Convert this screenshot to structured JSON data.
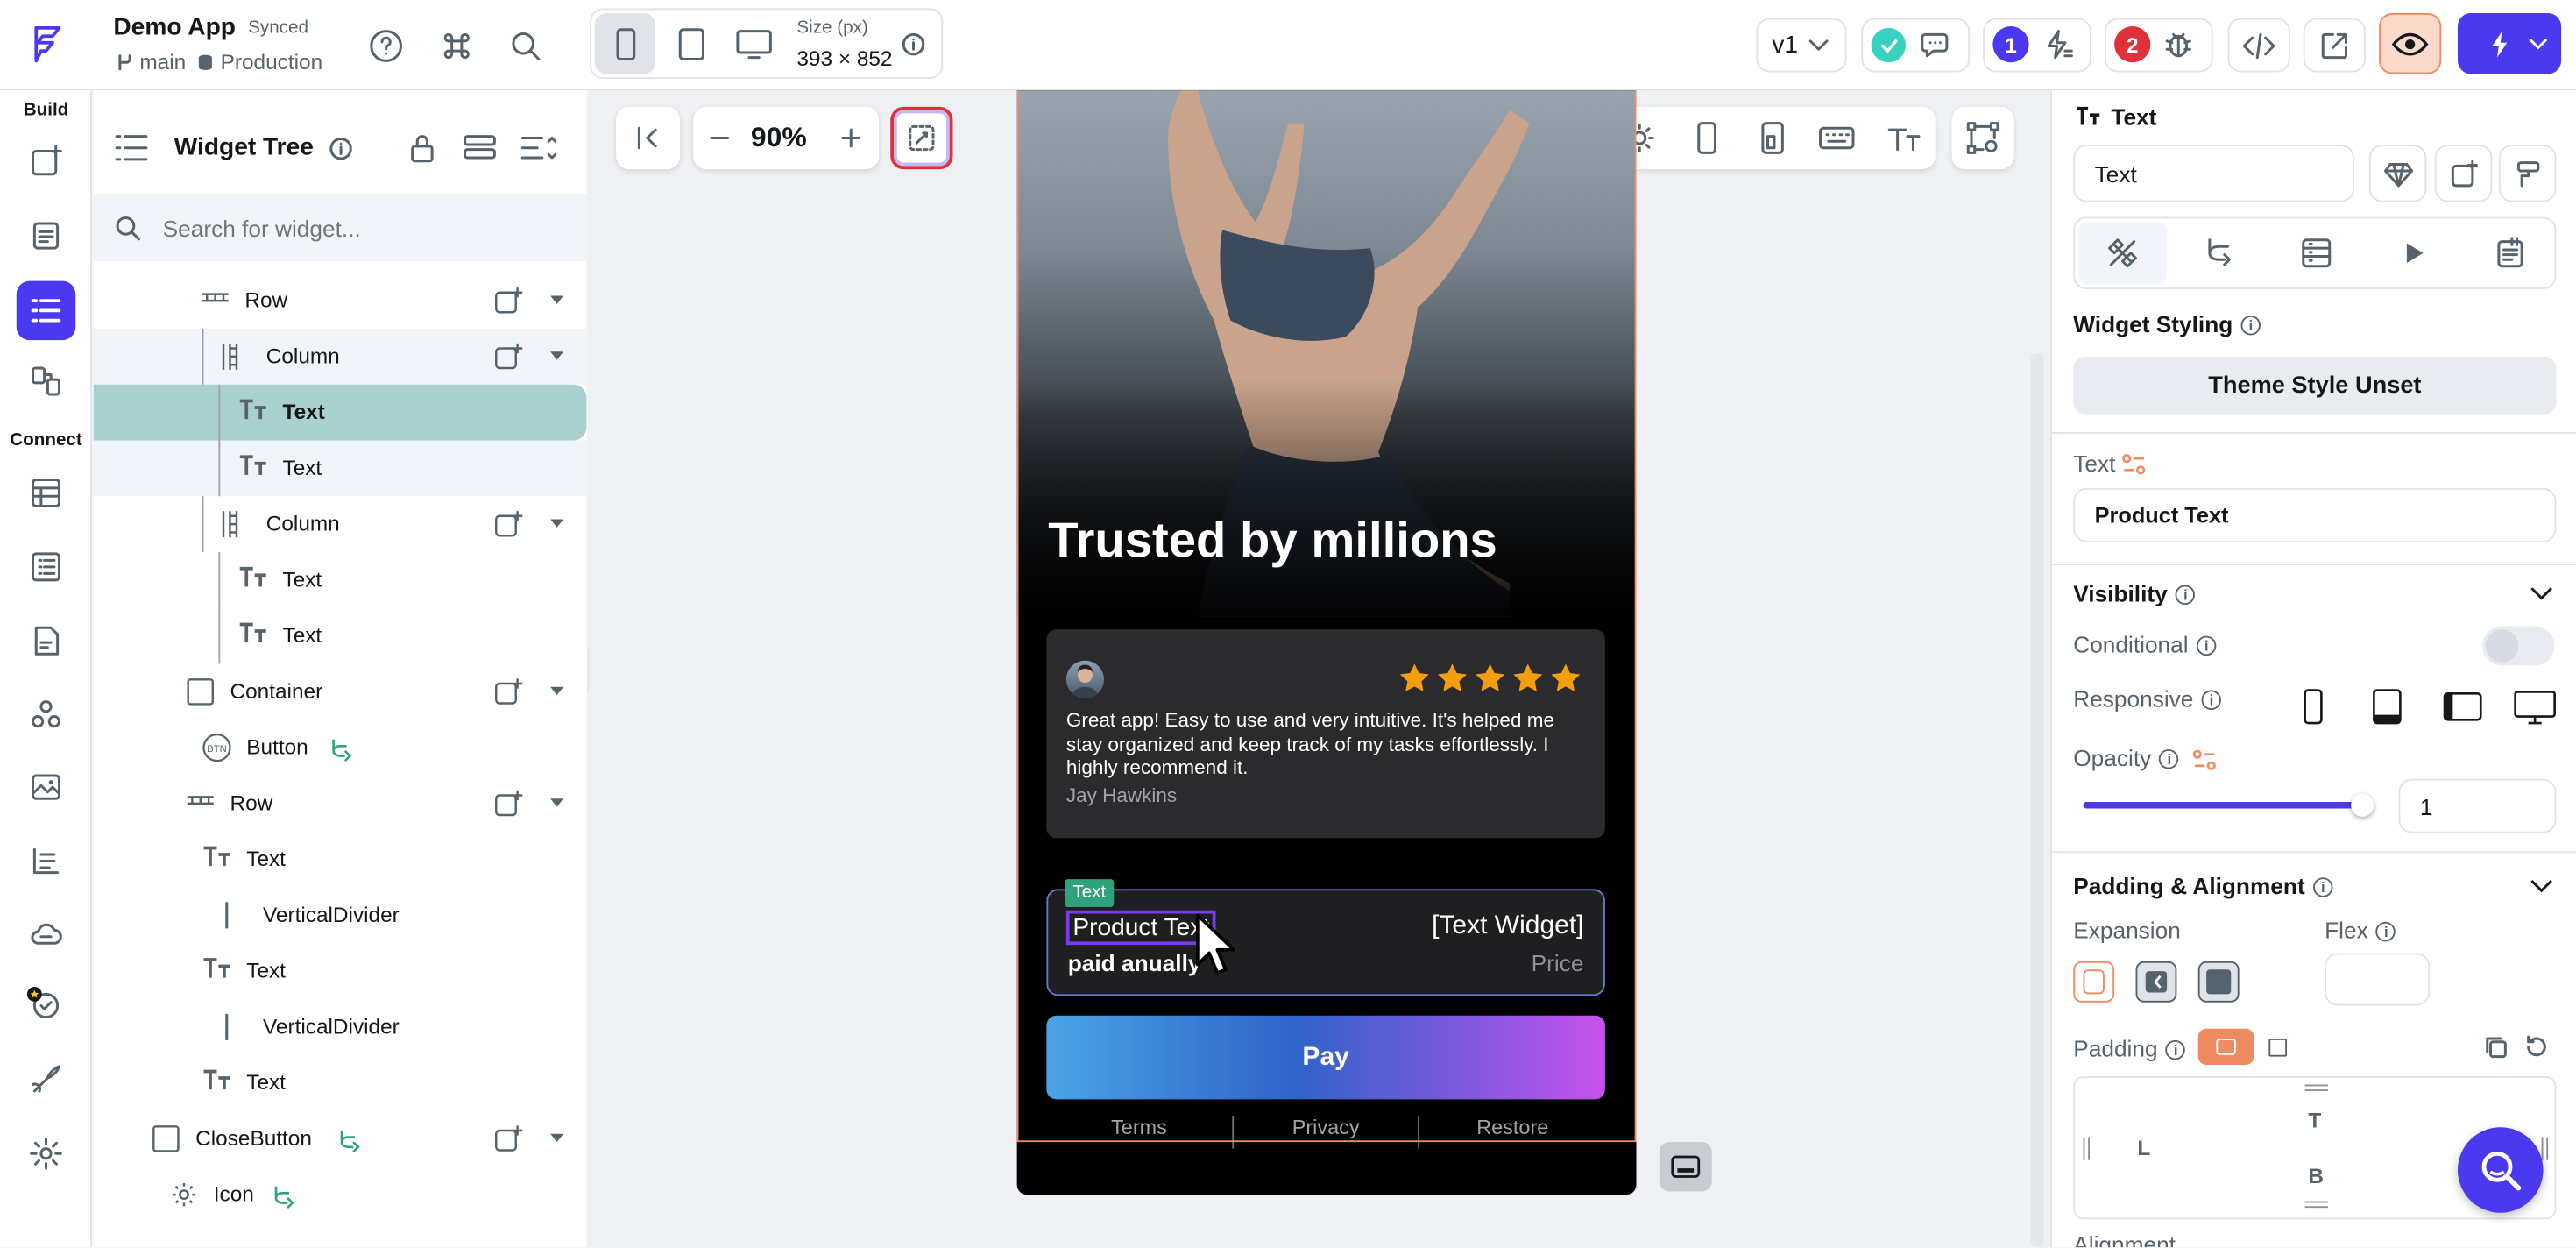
{
  "topbar": {
    "app_name": "Demo App",
    "sync_status": "Synced",
    "branch": "main",
    "environment": "Production",
    "size_label": "Size (px)",
    "size_value": "393 × 852",
    "version": "v1",
    "issues_count": "1",
    "bugs_count": "2"
  },
  "rail": {
    "build_label": "Build",
    "connect_label": "Connect"
  },
  "tree": {
    "title": "Widget Tree",
    "search_placeholder": "Search for widget...",
    "items": [
      {
        "label": "Row",
        "icon": "row-icon"
      },
      {
        "label": "Column",
        "icon": "column-icon"
      },
      {
        "label": "Text",
        "icon": "text-icon"
      },
      {
        "label": "Text",
        "icon": "text-icon"
      },
      {
        "label": "Column",
        "icon": "column-icon"
      },
      {
        "label": "Text",
        "icon": "text-icon"
      },
      {
        "label": "Text",
        "icon": "text-icon"
      },
      {
        "label": "Container",
        "icon": "container-icon"
      },
      {
        "label": "Button",
        "icon": "button-icon"
      },
      {
        "label": "Row",
        "icon": "row-icon"
      },
      {
        "label": "Text",
        "icon": "text-icon"
      },
      {
        "label": "VerticalDivider",
        "icon": "divider-icon"
      },
      {
        "label": "Text",
        "icon": "text-icon"
      },
      {
        "label": "VerticalDivider",
        "icon": "divider-icon"
      },
      {
        "label": "Text",
        "icon": "text-icon"
      },
      {
        "label": "CloseButton",
        "icon": "container-icon"
      },
      {
        "label": "Icon",
        "icon": "gear-icon"
      }
    ]
  },
  "canvas": {
    "zoom": "90%",
    "screen": {
      "headline": "Trusted by millions",
      "review_text": "Great app! Easy to use and very intuitive. It's helped me stay organized and keep track of my tasks effortlessly.  I highly recommend it.",
      "reviewer": "Jay Hawkins",
      "rating": 5,
      "selected_tag": "Text",
      "product_text": "Product Text",
      "billing_text": "paid anually",
      "price_widget": "[Text Widget]",
      "price_label": "Price",
      "pay_button": "Pay",
      "footer_links": [
        "Terms",
        "Privacy",
        "Restore"
      ]
    }
  },
  "props": {
    "widget_type": "Text",
    "widget_name": "Text",
    "styling_label": "Widget Styling",
    "theme_style_button": "Theme Style Unset",
    "text_label": "Text",
    "text_value": "Product Text",
    "visibility_label": "Visibility",
    "conditional_label": "Conditional",
    "responsive_label": "Responsive",
    "opacity_label": "Opacity",
    "opacity_value": "1",
    "opacity_fraction": 0.97,
    "padding_alignment_label": "Padding & Alignment",
    "expansion_label": "Expansion",
    "flex_label": "Flex",
    "padding_label": "Padding",
    "pad_top": "T",
    "pad_left": "L",
    "pad_bottom": "B",
    "alignment_label": "Alignment"
  },
  "colors": {
    "accent": "#4b39ef",
    "selected_row": "#a8d0cc",
    "selection_border": "#7c3aed",
    "orange": "#ee8b60",
    "star": "#f59e0b"
  }
}
